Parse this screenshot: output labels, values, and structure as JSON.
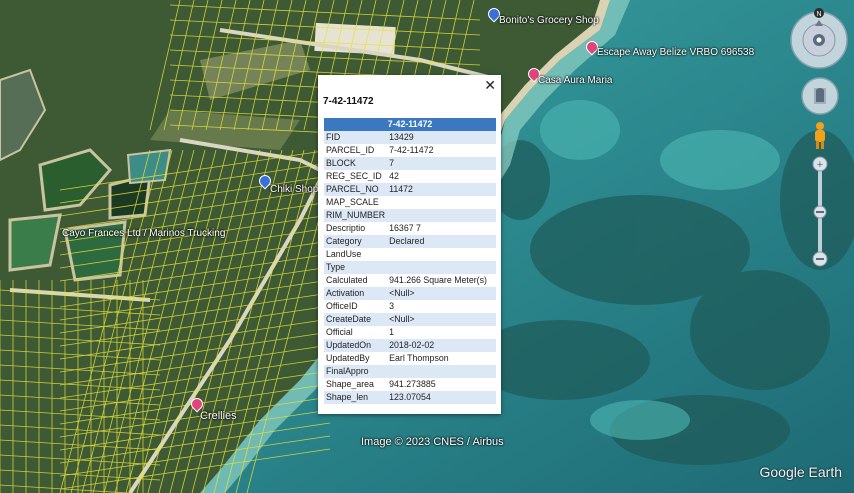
{
  "popup": {
    "title": "7-42-11472",
    "header": "7-42-11472",
    "close_glyph": "✕",
    "rows": [
      {
        "key": "FID",
        "value": "13429"
      },
      {
        "key": "PARCEL_ID",
        "value": "7-42-11472"
      },
      {
        "key": "BLOCK",
        "value": "7"
      },
      {
        "key": "REG_SEC_ID",
        "value": "42"
      },
      {
        "key": "PARCEL_NO",
        "value": "11472"
      },
      {
        "key": "MAP_SCALE",
        "value": ""
      },
      {
        "key": "RIM_NUMBER",
        "value": ""
      },
      {
        "key": "Descriptio",
        "value": "16367 7"
      },
      {
        "key": "Category",
        "value": "Declared"
      },
      {
        "key": "LandUse",
        "value": ""
      },
      {
        "key": "Type",
        "value": ""
      },
      {
        "key": "Calculated",
        "value": "941.266 Square Meter(s)"
      },
      {
        "key": "Activation",
        "value": "<Null>"
      },
      {
        "key": "OfficeID",
        "value": "3"
      },
      {
        "key": "CreateDate",
        "value": "<Null>"
      },
      {
        "key": "Official",
        "value": "1"
      },
      {
        "key": "UpdatedOn",
        "value": "2018-02-02"
      },
      {
        "key": "UpdatedBy",
        "value": "Earl Thompson"
      },
      {
        "key": "FinalAppro",
        "value": ""
      },
      {
        "key": "Shape_area",
        "value": "941.273885"
      },
      {
        "key": "Shape_len",
        "value": "123.07054"
      }
    ]
  },
  "places": {
    "grocery": "Bonito's Grocery Shop",
    "escape": "Escape Away Belize VRBO 696538",
    "casa": "Casa Aura Maria",
    "chiki": "Chiki Shop",
    "cayo": "Cayo Frances Ltd / Marinos Trucking",
    "crellies": "Crellies"
  },
  "credit": "Image © 2023 CNES / Airbus",
  "brand": "Google Earth",
  "compass_north": "N",
  "colors": {
    "parcel_lines": "#e8e23a",
    "popup_header": "#3b78c0",
    "row_alt": "#dde8f6"
  }
}
